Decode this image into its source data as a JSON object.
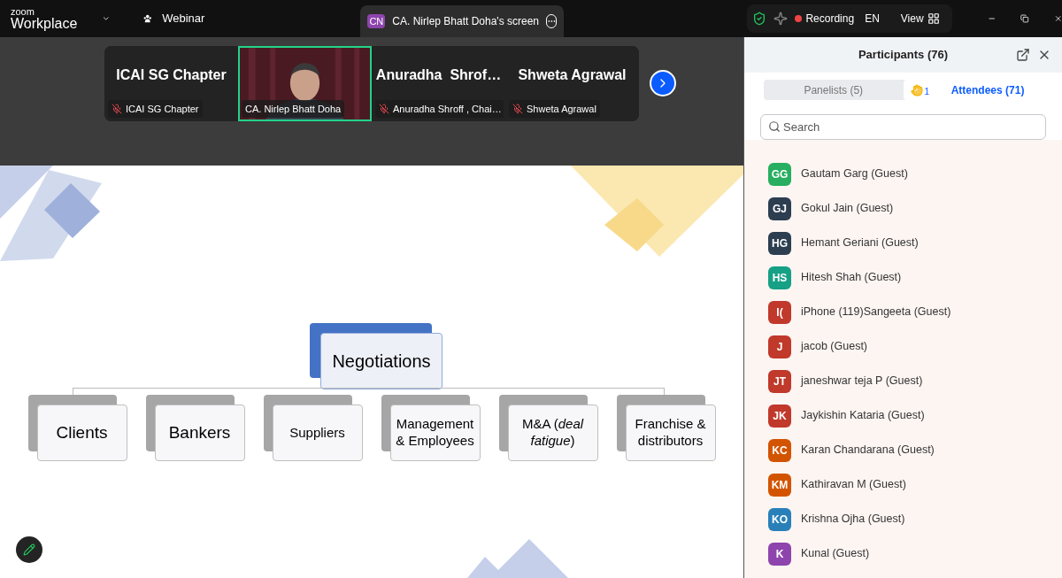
{
  "top_bar": {
    "logo_top": "zoom",
    "logo_bottom": "Workplace",
    "webinar": "Webinar",
    "share_tab": {
      "initials": "CN",
      "title": "CA. Nirlep Bhatt Doha's screen"
    },
    "recording": {
      "label": "Recording",
      "on": true
    },
    "language": "EN",
    "view": "View"
  },
  "video_strip": {
    "tiles": [
      {
        "kind": "name",
        "display": "ICAI SG Chapter",
        "name": "ICAI SG Chapter",
        "muted": true,
        "selected": false
      },
      {
        "kind": "video",
        "name": "CA. Nirlep Bhatt Doha",
        "muted": false,
        "selected": true
      },
      {
        "kind": "name",
        "display": "Anuradha  Shrof…",
        "name": "Anuradha Shroff , Chai…",
        "muted": true,
        "selected": false
      },
      {
        "kind": "name",
        "display": "Shweta Agrawal",
        "name": "Shweta Agrawal",
        "muted": true,
        "selected": false
      }
    ]
  },
  "slide": {
    "root": "Negotiations",
    "branches": [
      "Clients",
      "Bankers",
      "Suppliers",
      "Management & Employees",
      "M&A (*deal fatigue*)",
      "Franchise & distributors"
    ]
  },
  "participants": {
    "title": "Participants (76)",
    "tabs": [
      {
        "label": "Panelists (5)",
        "selected": false
      },
      {
        "label": "Attendees (71)",
        "selected": true,
        "raised_hands": "1"
      }
    ],
    "search": {
      "placeholder": "Search"
    },
    "items": [
      {
        "initials": "GG",
        "name": "Gautam Garg (Guest)",
        "color": "#27ae60"
      },
      {
        "initials": "GJ",
        "name": "Gokul Jain (Guest)",
        "color": "#2c3e50"
      },
      {
        "initials": "HG",
        "name": "Hemant Geriani (Guest)",
        "color": "#2c3e50"
      },
      {
        "initials": "HS",
        "name": "Hitesh Shah (Guest)",
        "color": "#16a085"
      },
      {
        "initials": "I(",
        "name": "iPhone (119)Sangeeta (Guest)",
        "color": "#c0392b"
      },
      {
        "initials": "J",
        "name": "jacob (Guest)",
        "color": "#c0392b"
      },
      {
        "initials": "JT",
        "name": "janeshwar teja P (Guest)",
        "color": "#c0392b"
      },
      {
        "initials": "JK",
        "name": "Jaykishin Kataria (Guest)",
        "color": "#c0392b"
      },
      {
        "initials": "KC",
        "name": "Karan Chandarana (Guest)",
        "color": "#d35400"
      },
      {
        "initials": "KM",
        "name": "Kathiravan M (Guest)",
        "color": "#d35400"
      },
      {
        "initials": "KO",
        "name": "Krishna Ojha (Guest)",
        "color": "#2980b9"
      },
      {
        "initials": "K",
        "name": "Kunal (Guest)",
        "color": "#8e44ad"
      }
    ]
  }
}
